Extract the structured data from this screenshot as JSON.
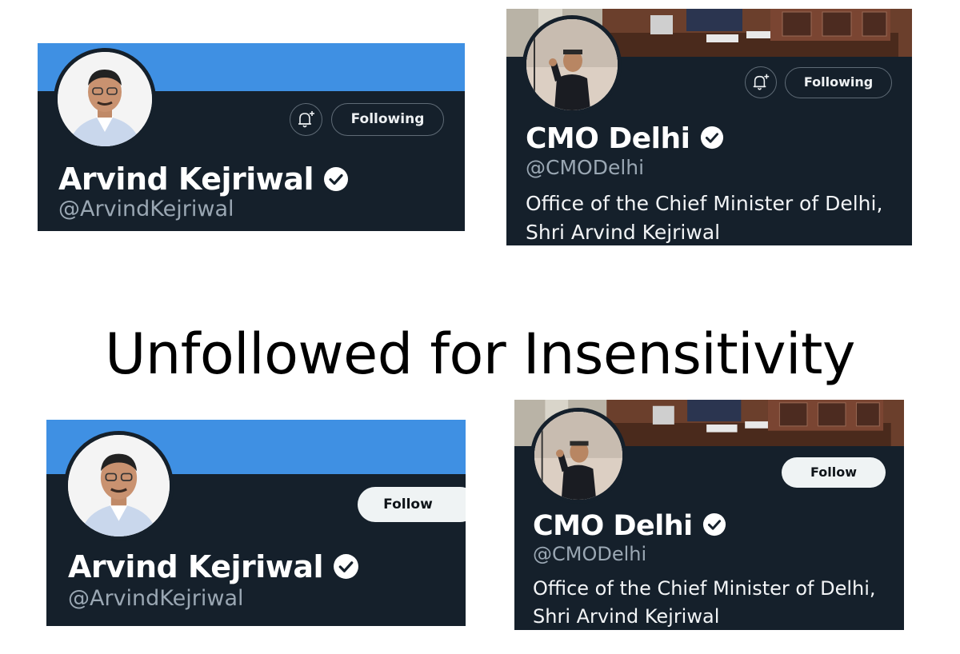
{
  "caption": "Unfollowed for Insensitivity",
  "colors": {
    "card_background": "#15202b",
    "banner_blue": "#3f90e3",
    "handle_gray": "#9aa7b3",
    "follow_button_bg": "#eff3f4"
  },
  "before": {
    "arvind": {
      "name": "Arvind Kejriwal",
      "handle": "@ArvindKejriwal",
      "button_label": "Following",
      "verified": true,
      "icons": [
        "notification-bell-icon",
        "verified-badge-icon"
      ]
    },
    "cmo": {
      "name": "CMO Delhi",
      "handle": "@CMODelhi",
      "bio_line1": "Office of the Chief Minister of Delhi,",
      "bio_line2": "Shri Arvind Kejriwal",
      "button_label": "Following",
      "verified": true,
      "icons": [
        "notification-bell-icon",
        "verified-badge-icon"
      ]
    }
  },
  "after": {
    "arvind": {
      "name": "Arvind Kejriwal",
      "handle": "@ArvindKejriwal",
      "button_label": "Follow",
      "verified": true
    },
    "cmo": {
      "name": "CMO Delhi",
      "handle": "@CMODelhi",
      "bio_line1": "Office of the Chief Minister of Delhi,",
      "bio_line2": "Shri Arvind Kejriwal",
      "button_label": "Follow",
      "verified": true
    }
  }
}
